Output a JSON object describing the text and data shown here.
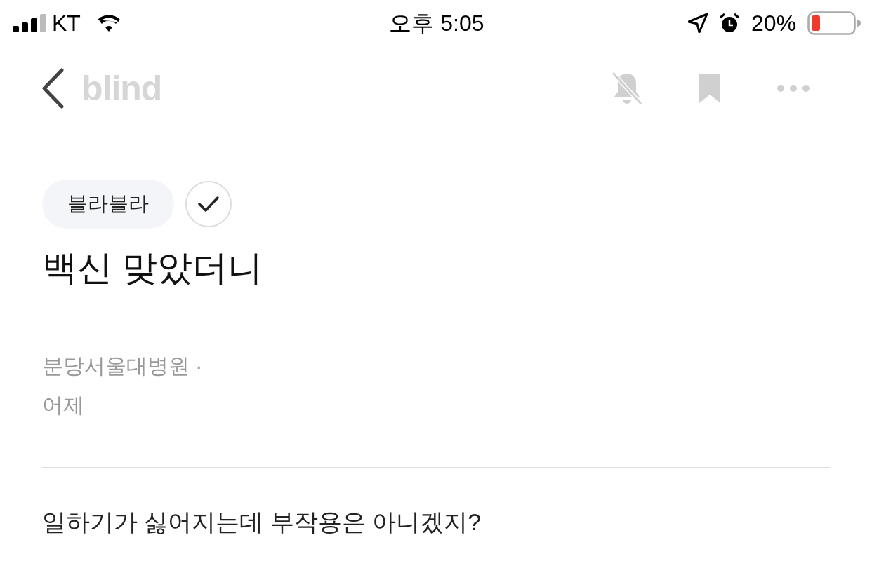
{
  "status_bar": {
    "carrier": "KT",
    "time": "오후 5:05",
    "battery": "20%"
  },
  "nav": {
    "logo": "blind"
  },
  "post": {
    "tag": "블라블라",
    "title": "백신 맞았더니",
    "author": "분당서울대병원 ·",
    "date": "어제",
    "body": "일하기가 싫어지는데 부작용은 아니겠지?"
  }
}
